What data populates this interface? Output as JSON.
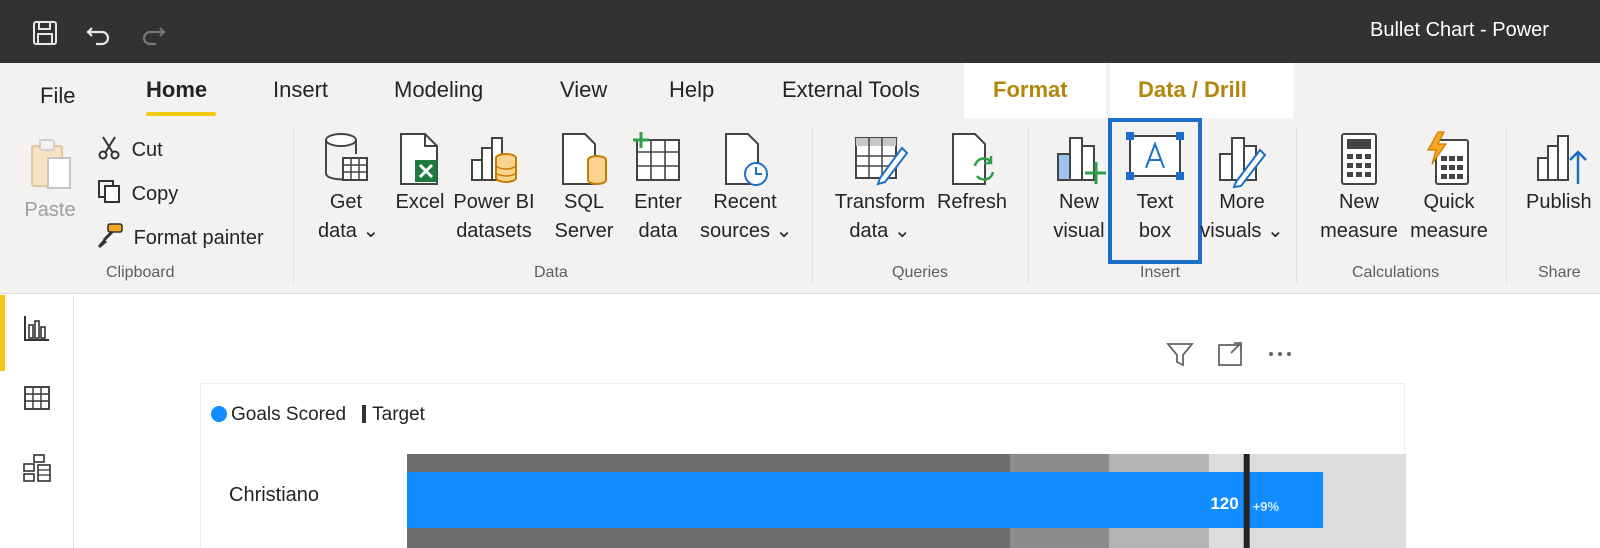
{
  "window": {
    "title": "Bullet Chart - Power"
  },
  "tabs": [
    {
      "label": "File"
    },
    {
      "label": "Home"
    },
    {
      "label": "Insert"
    },
    {
      "label": "Modeling"
    },
    {
      "label": "View"
    },
    {
      "label": "Help"
    },
    {
      "label": "External Tools"
    },
    {
      "label": "Format"
    },
    {
      "label": "Data / Drill"
    }
  ],
  "ribbon": {
    "clipboard": {
      "group_label": "Clipboard",
      "paste": "Paste",
      "cut": "Cut",
      "copy": "Copy",
      "format_painter": "Format painter"
    },
    "data": {
      "group_label": "Data",
      "get_data": [
        "Get",
        "data ⌄"
      ],
      "excel": [
        "",
        "Excel"
      ],
      "power_bi_datasets": [
        "Power BI",
        "datasets"
      ],
      "sql_server": [
        "SQL",
        "Server"
      ],
      "enter_data": [
        "Enter",
        "data"
      ],
      "recent_sources": [
        "Recent",
        "sources ⌄"
      ]
    },
    "queries": {
      "group_label": "Queries",
      "transform_data": [
        "Transform",
        "data ⌄"
      ],
      "refresh": [
        "",
        "Refresh"
      ]
    },
    "insert": {
      "group_label": "Insert",
      "new_visual": [
        "New",
        "visual"
      ],
      "text_box": [
        "Text",
        "box"
      ],
      "more_visuals": [
        "More",
        "visuals ⌄"
      ]
    },
    "calculations": {
      "group_label": "Calculations",
      "new_measure": [
        "New",
        "measure"
      ],
      "quick_measure": [
        "Quick",
        "measure"
      ]
    },
    "share": {
      "group_label": "Share",
      "publish": [
        "",
        "Publish"
      ]
    }
  },
  "colors": {
    "accent_yellow": "#f2c811",
    "highlight_blue": "#1b6fc8",
    "bar_blue": "#118dff",
    "titlebar": "#333230",
    "ribbon_bg": "#f3f2f1",
    "context_tab_text": "#b2870d"
  },
  "chart_data": {
    "type": "bar",
    "legend": [
      "Goals Scored",
      "Target"
    ],
    "categories": [
      "Christiano"
    ],
    "series": [
      {
        "name": "Goals Scored",
        "values": [
          120
        ]
      },
      {
        "name": "Target",
        "values": [
          110
        ]
      }
    ],
    "data_labels": [
      {
        "value": "120",
        "variance": "+9%"
      }
    ]
  }
}
